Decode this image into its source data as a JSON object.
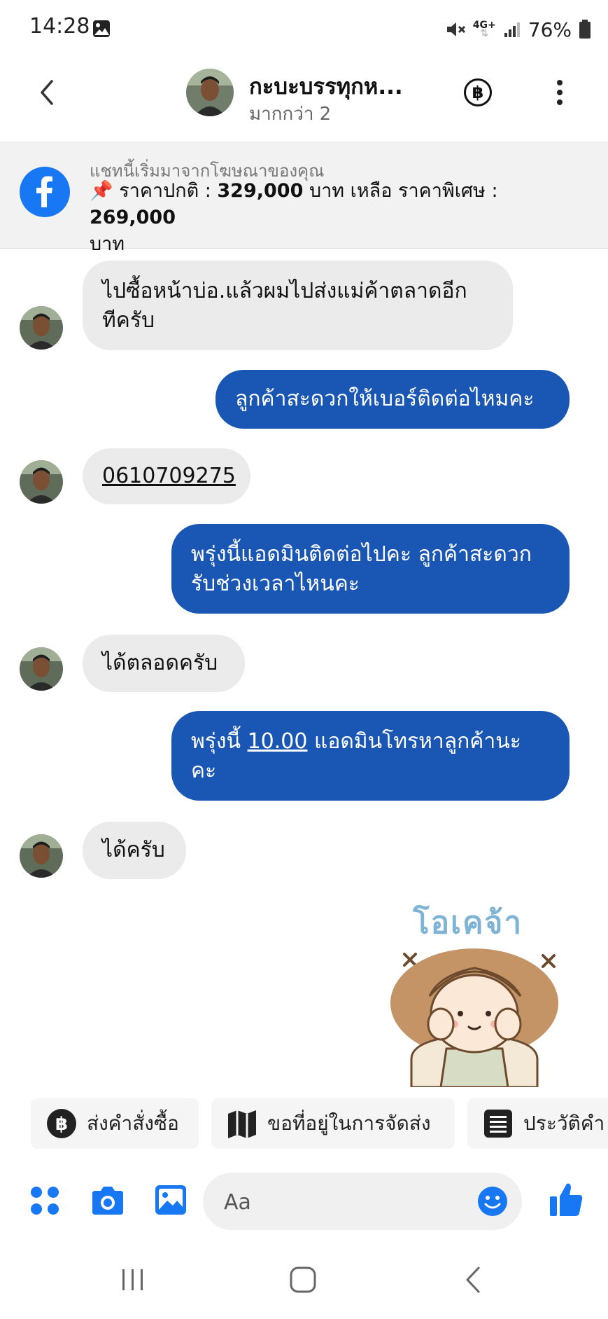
{
  "status": {
    "time": "14:28",
    "network": "4G+",
    "battery": "76%"
  },
  "header": {
    "title": "กะบะบรรทุกห...",
    "subtitle": "มากกว่า 2",
    "payment_icon": "baht-icon",
    "more_icon": "more-vertical-icon"
  },
  "ad": {
    "caption": "แชทนี้เริ่มมาจากโฆษณาของคุณ",
    "pin": "📌",
    "text_part1": " ราคาปกติ : ",
    "price_normal": "329,000",
    "text_part2": " บาท เหลือ ราคาพิเศษ : ",
    "price_special": "269,000",
    "text_part3": " บาท"
  },
  "messages": [
    {
      "dir": "in",
      "text_line1": "ไปซื้อหน้าบ่อ.แล้วผมไปส่งแม่ค้าตลาดอีก",
      "text_line2": "ทีครับ"
    },
    {
      "dir": "out",
      "text": "ลูกค้าสะดวกให้เบอร์ติดต่อไหมคะ"
    },
    {
      "dir": "in",
      "phone": "0610709275"
    },
    {
      "dir": "out",
      "text_line1": "พรุ่งนี้แอดมินติดต่อไปคะ ลูกค้าสะดวก",
      "text_line2": "รับช่วงเวลาไหนคะ"
    },
    {
      "dir": "in",
      "text": "ได้ตลอดครับ"
    },
    {
      "dir": "out",
      "text_pre": "พรุ่งนี้ ",
      "time": "10.00",
      "text_post": " แอดมินโทรหาลูกค้านะ",
      "text_line2": "คะ"
    },
    {
      "dir": "in",
      "text": "ได้ครับ"
    }
  ],
  "sticker": {
    "text": "โอเคจ้า"
  },
  "quick_replies": [
    {
      "label": "ส่งคำสั่งซื้อ",
      "icon": "baht-circle-icon"
    },
    {
      "label": "ขอที่อยู่ในการจัดส่ง",
      "icon": "map-icon"
    },
    {
      "label": "ประวัติคำ",
      "icon": "list-icon"
    }
  ],
  "composer": {
    "placeholder": "Aa"
  },
  "colors": {
    "accent": "#1877f2",
    "outgoing_bubble": "#1a56b3",
    "incoming_bubble": "#ebebeb"
  }
}
